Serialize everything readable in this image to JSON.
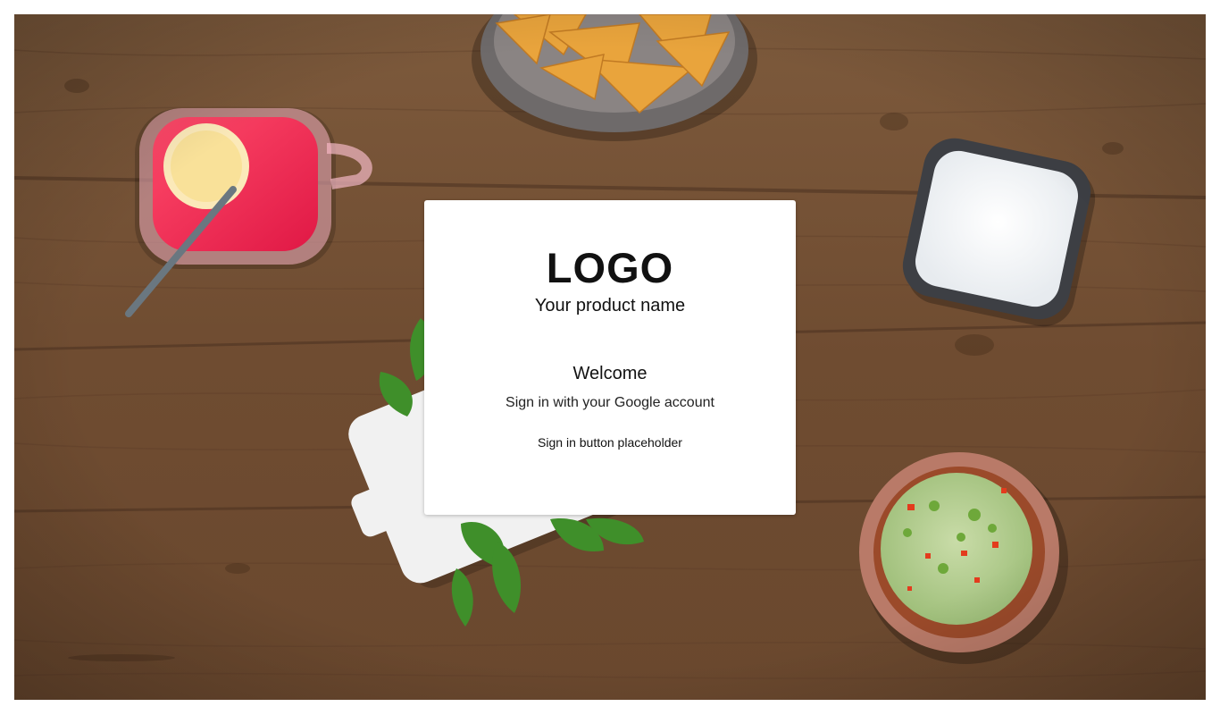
{
  "background": {
    "description_icon": "food-table-photo"
  },
  "card": {
    "logo": "LOGO",
    "product_name": "Your product name",
    "welcome": "Welcome",
    "subtitle": "Sign in with your Google account",
    "signin_button": "Sign in button placeholder"
  },
  "colors": {
    "wood": "#7a5538",
    "card_bg": "#ffffff",
    "text": "#111111"
  }
}
